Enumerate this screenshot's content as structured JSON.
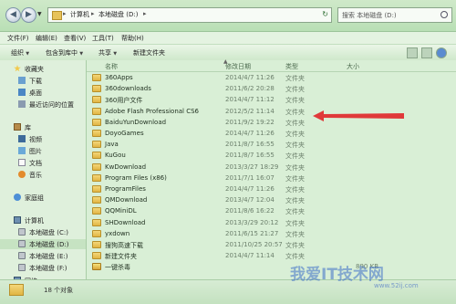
{
  "address": {
    "crumbs": [
      "计算机",
      "本地磁盘 (D:)"
    ],
    "search_placeholder": "搜索 本地磁盘 (D:)"
  },
  "menu": [
    "文件(F)",
    "编辑(E)",
    "查看(V)",
    "工具(T)",
    "帮助(H)"
  ],
  "toolbar": {
    "organize": "组织",
    "include_library": "包含到库中",
    "share": "共享",
    "new_folder": "新建文件夹"
  },
  "sidebar": {
    "favorites": "收藏夹",
    "downloads": "下载",
    "desktop": "桌面",
    "recent": "最近访问的位置",
    "libraries": "库",
    "videos": "视频",
    "pictures": "图片",
    "documents": "文档",
    "music": "音乐",
    "homegroup": "家庭组",
    "computer": "计算机",
    "drive_c": "本地磁盘 (C:)",
    "drive_d": "本地磁盘 (D:)",
    "drive_e": "本地磁盘 (E:)",
    "drive_f": "本地磁盘 (F:)",
    "network": "网络"
  },
  "columns": {
    "name": "名称",
    "date": "修改日期",
    "type": "类型",
    "size": "大小"
  },
  "files": [
    {
      "name": "360Apps",
      "date": "2014/4/7 11:26",
      "type": "文件夹",
      "size": ""
    },
    {
      "name": "360downloads",
      "date": "2011/6/2 20:28",
      "type": "文件夹",
      "size": ""
    },
    {
      "name": "360用户文件",
      "date": "2014/4/7 11:12",
      "type": "文件夹",
      "size": ""
    },
    {
      "name": "Adobe Flash Professional CS6",
      "date": "2012/5/2 11:14",
      "type": "文件夹",
      "size": ""
    },
    {
      "name": "BaiduYunDownload",
      "date": "2011/9/2 19:22",
      "type": "文件夹",
      "size": ""
    },
    {
      "name": "DoyoGames",
      "date": "2014/4/7 11:26",
      "type": "文件夹",
      "size": ""
    },
    {
      "name": "Java",
      "date": "2011/8/7 16:55",
      "type": "文件夹",
      "size": ""
    },
    {
      "name": "KuGou",
      "date": "2011/8/7 16:55",
      "type": "文件夹",
      "size": ""
    },
    {
      "name": "KwDownload",
      "date": "2013/3/27 18:29",
      "type": "文件夹",
      "size": ""
    },
    {
      "name": "Program Files (x86)",
      "date": "2011/7/1 16:07",
      "type": "文件夹",
      "size": ""
    },
    {
      "name": "ProgramFiles",
      "date": "2014/4/7 11:26",
      "type": "文件夹",
      "size": ""
    },
    {
      "name": "QMDownload",
      "date": "2013/4/7 12:04",
      "type": "文件夹",
      "size": ""
    },
    {
      "name": "QQMiniDL",
      "date": "2011/8/6 16:22",
      "type": "文件夹",
      "size": ""
    },
    {
      "name": "SHDownload",
      "date": "2013/3/29 20:12",
      "type": "文件夹",
      "size": ""
    },
    {
      "name": "yxdown",
      "date": "2011/6/15 21:27",
      "type": "文件夹",
      "size": ""
    },
    {
      "name": "搜狗高速下载",
      "date": "2011/10/25 20:57",
      "type": "文件夹",
      "size": ""
    },
    {
      "name": "新建文件夹",
      "date": "2014/4/7 11:14",
      "type": "文件夹",
      "size": ""
    },
    {
      "name": "一键杀毒",
      "date": "",
      "type": "",
      "size": "890 KB"
    }
  ],
  "status": {
    "count": "18 个对象"
  },
  "watermark": {
    "text": "我爱IT技术网",
    "url": "www.52ij.com"
  },
  "colors": {
    "window_bg": "#d9efd6",
    "arrow": "#e0393a",
    "folder": "#e1b544"
  }
}
